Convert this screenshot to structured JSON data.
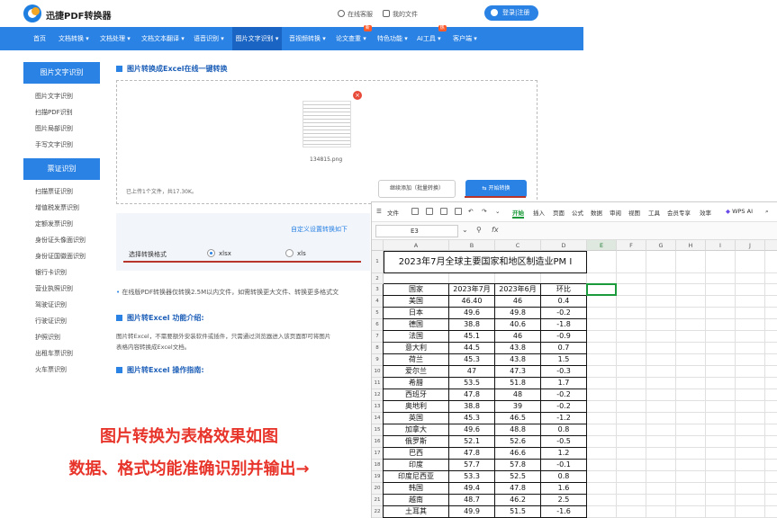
{
  "header": {
    "logo_text": "迅捷PDF转换器",
    "support": "在线客服",
    "my_files": "我的文件",
    "login": "登录|注册"
  },
  "nav": {
    "items": [
      "首页",
      "文档转换 ▾",
      "文档处理 ▾",
      "文档文本翻译 ▾",
      "语音识别 ▾",
      "图片文字识别 ▾",
      "音视频转换 ▾",
      "论文查重 ▾",
      "特色功能 ▾",
      "AI工具 ▾",
      "客户端 ▾"
    ],
    "badge_new": "新",
    "badge_hot": "热"
  },
  "sidebar": {
    "group1_title": "图片文字识别",
    "group1_items": [
      "图片文字识别",
      "扫描PDF识别",
      "图片局部识别",
      "手写文字识别"
    ],
    "group2_title": "票证识别",
    "group2_items": [
      "扫描票证识别",
      "增值税发票识别",
      "定额发票识别",
      "身份证头像面识别",
      "身份证国徽面识别",
      "银行卡识别",
      "营业执照识别",
      "驾驶证识别",
      "行驶证识别",
      "护照识别",
      "出租车票识别",
      "火车票识别"
    ]
  },
  "main": {
    "title": "图片转换成Excel在线一键转换",
    "file_name": "134815.png",
    "close_glyph": "×",
    "file_info": "已上传1个文件，共17.30K。",
    "add_button": "继续添加（批量转换）",
    "start_button": "开始转换",
    "custom_link": "自定义设置转换如下",
    "format_label": "选择转换格式",
    "format_options": [
      "xlsx",
      "xls"
    ],
    "format_selected": "xlsx",
    "notice": "在线版PDF转换器仅转换2.5M以内文件，如需转换更大文件、转换更多格式文",
    "intro_title": "图片转Excel 功能介绍:",
    "intro_text_1": "图片转Excel，不需要额外安装软件或插件，只需通过浏览器进入该页面即可将图片",
    "intro_text_2": "表格内容转换成Excel文档。",
    "guide_title": "图片转Excel 操作指南:"
  },
  "caption": {
    "line1": "图片转换为表格效果如图",
    "line2": "数据、格式均能准确识别并输出→"
  },
  "spreadsheet": {
    "menu_items": [
      "文件",
      "开始",
      "插入",
      "页面",
      "公式",
      "数据",
      "审阅",
      "视图",
      "工具",
      "会员专享",
      "效率",
      "WPS AI"
    ],
    "active_menu": "开始",
    "cell_ref": "E3",
    "fx_label": "fx",
    "columns": [
      "A",
      "B",
      "C",
      "D",
      "E",
      "F",
      "G",
      "H",
      "I",
      "J",
      "K"
    ],
    "row_numbers": [
      "1",
      "2",
      "3",
      "4",
      "5",
      "6",
      "7",
      "8",
      "9",
      "10",
      "11",
      "12",
      "13",
      "14",
      "15",
      "16",
      "17",
      "18",
      "19",
      "20",
      "21",
      "22"
    ],
    "title": "2023年7月全球主要国家和地区制造业PM I",
    "headers": [
      "国家",
      "2023年7月",
      "2023年6月",
      "环比"
    ],
    "rows": [
      [
        "美国",
        "46.40",
        "46",
        "0.4"
      ],
      [
        "日本",
        "49.6",
        "49.8",
        "-0.2"
      ],
      [
        "德国",
        "38.8",
        "40.6",
        "-1.8"
      ],
      [
        "法国",
        "45.1",
        "46",
        "-0.9"
      ],
      [
        "意大利",
        "44.5",
        "43.8",
        "0.7"
      ],
      [
        "荷兰",
        "45.3",
        "43.8",
        "1.5"
      ],
      [
        "爱尔兰",
        "47",
        "47.3",
        "-0.3"
      ],
      [
        "希腊",
        "53.5",
        "51.8",
        "1.7"
      ],
      [
        "西班牙",
        "47.8",
        "48",
        "-0.2"
      ],
      [
        "奥地利",
        "38.8",
        "39",
        "-0.2"
      ],
      [
        "英国",
        "45.3",
        "46.5",
        "-1.2"
      ],
      [
        "加拿大",
        "49.6",
        "48.8",
        "0.8"
      ],
      [
        "俄罗斯",
        "52.1",
        "52.6",
        "-0.5"
      ],
      [
        "巴西",
        "47.8",
        "46.6",
        "1.2"
      ],
      [
        "印度",
        "57.7",
        "57.8",
        "-0.1"
      ],
      [
        "印度尼西亚",
        "53.3",
        "52.5",
        "0.8"
      ],
      [
        "韩国",
        "49.4",
        "47.8",
        "1.6"
      ],
      [
        "越南",
        "48.7",
        "46.2",
        "2.5"
      ],
      [
        "土耳其",
        "49.9",
        "51.5",
        "-1.6"
      ]
    ]
  }
}
